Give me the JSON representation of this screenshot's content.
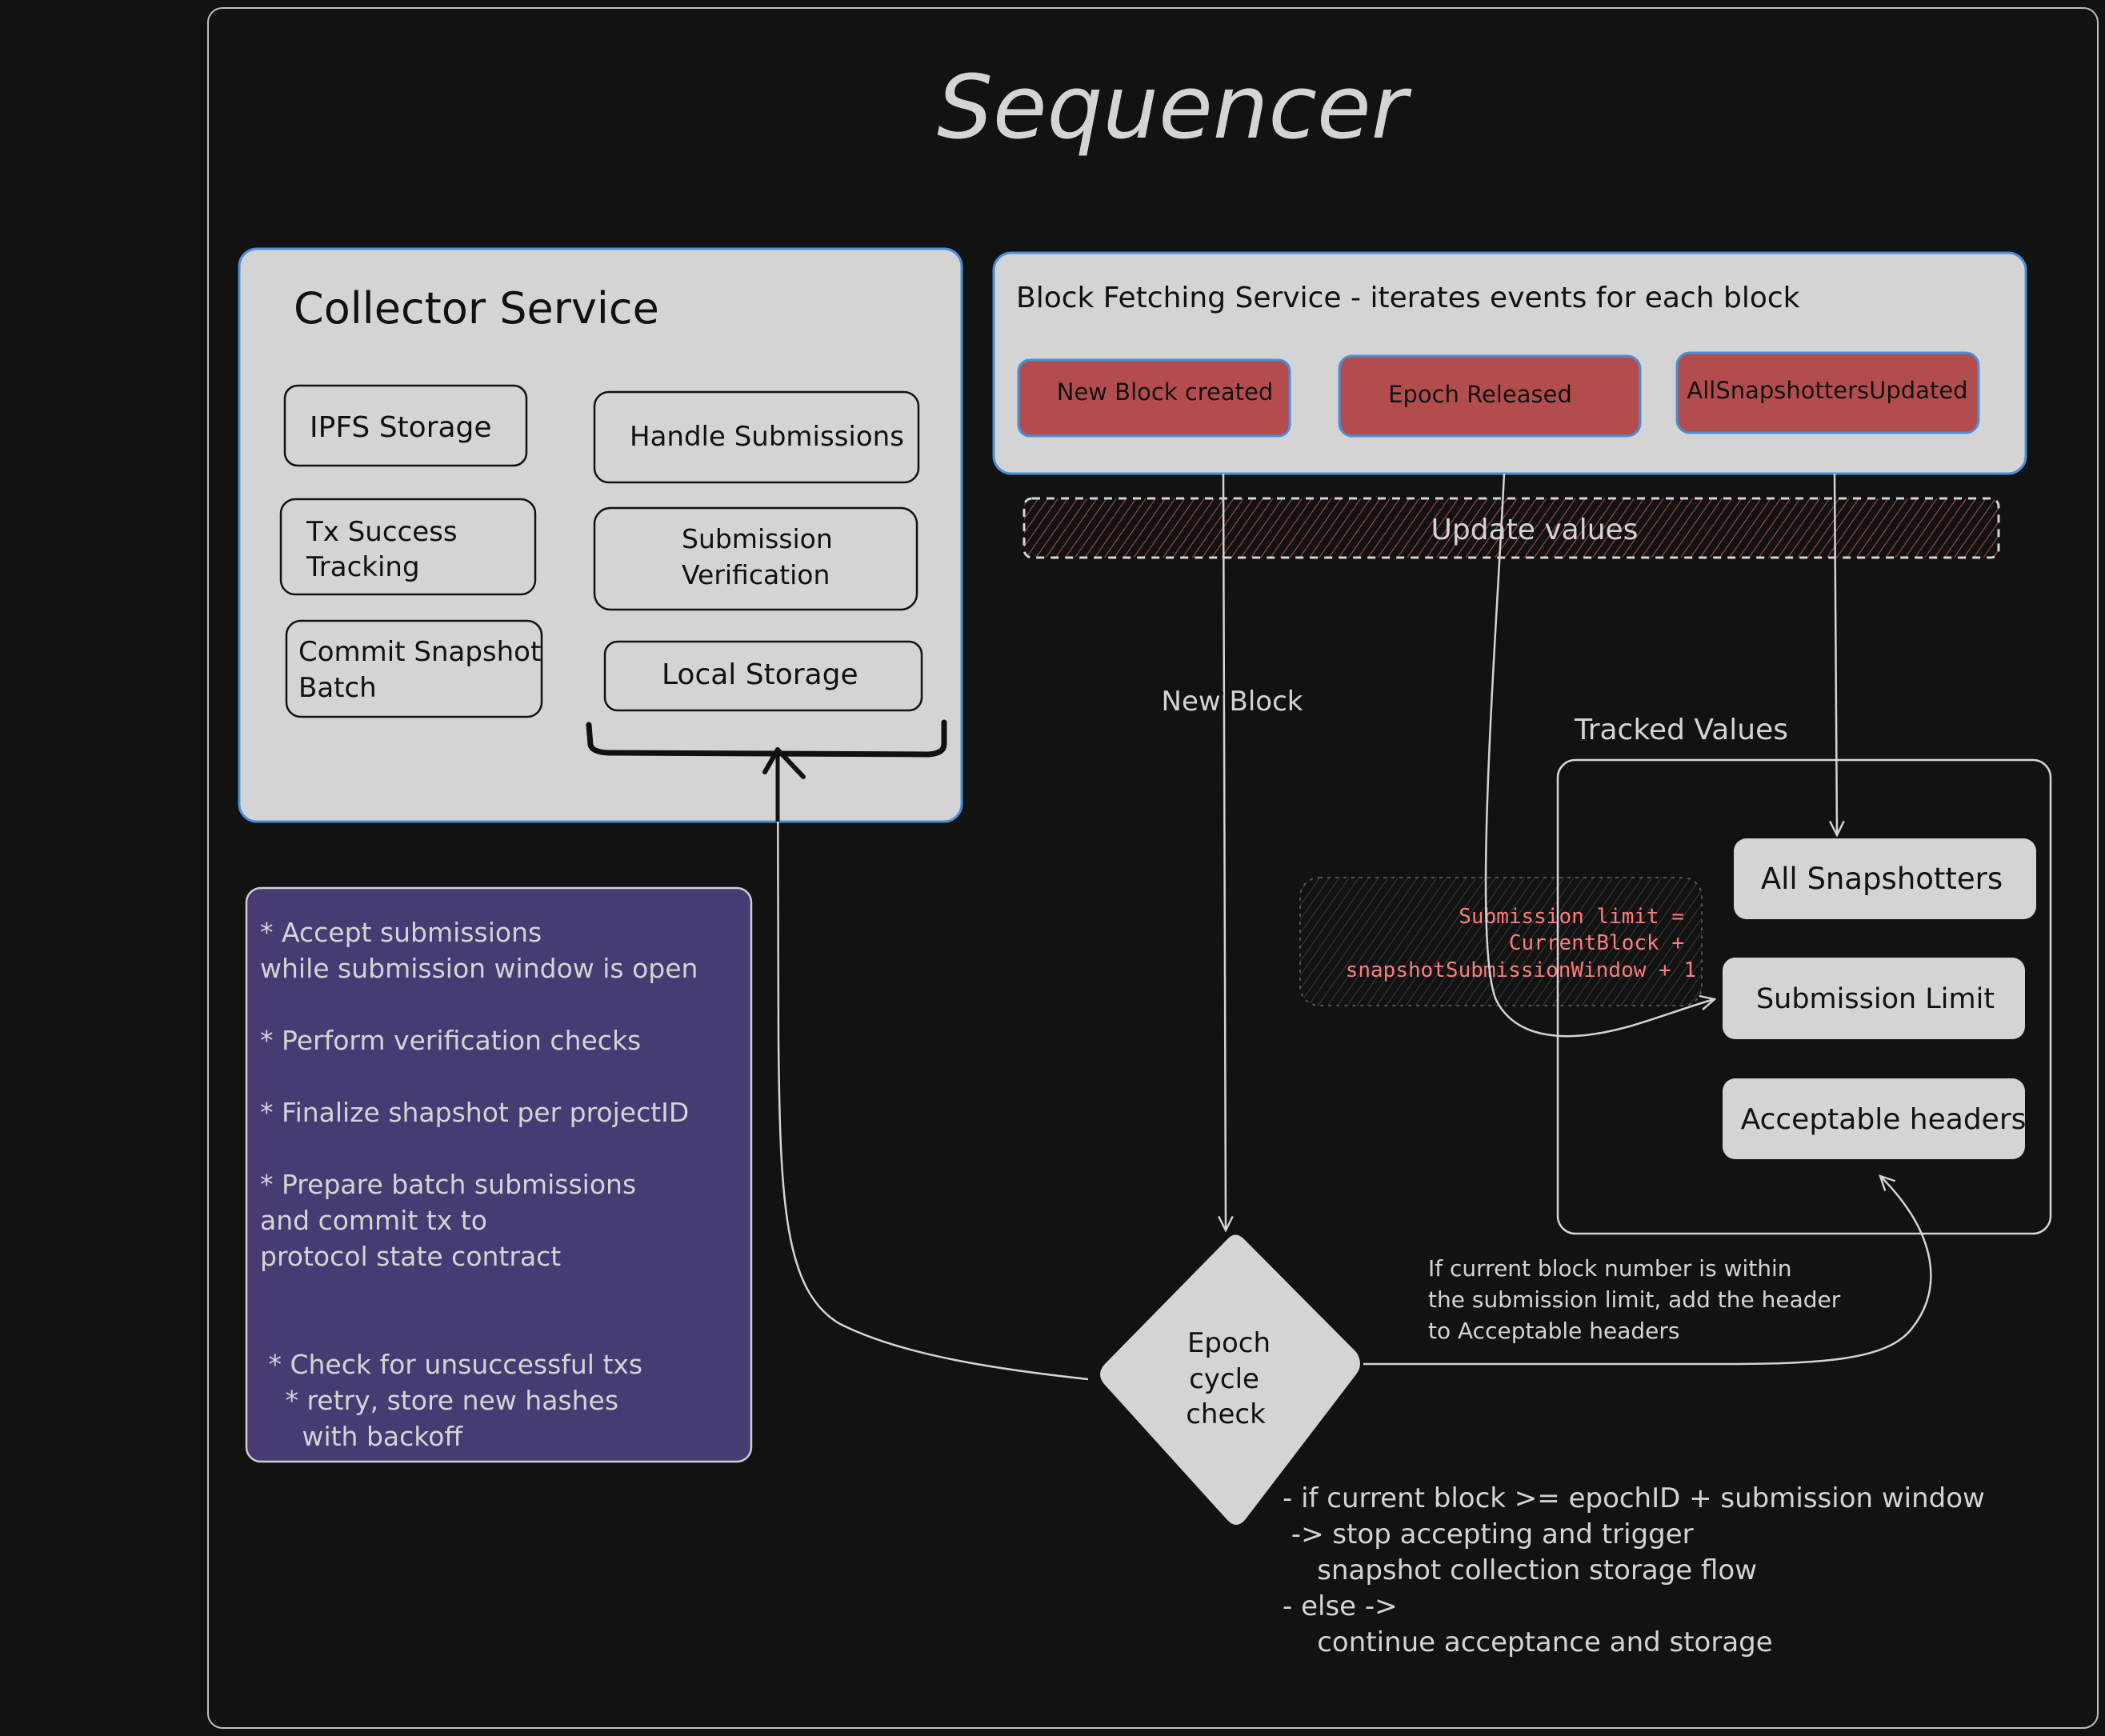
{
  "diagram": {
    "title": "Sequencer",
    "colors": {
      "background": "#121212",
      "panel_fill": "#d4d4d4",
      "panel_border_accent": "#4a90d9",
      "event_fill": "#b34d4d",
      "notes_fill": "#483a72",
      "formula_text": "#ff7b7b",
      "stroke_light": "#d4d4d4"
    },
    "collector_service": {
      "title": "Collector Service",
      "components": [
        {
          "id": "ipfs-storage",
          "lines": [
            "IPFS Storage"
          ]
        },
        {
          "id": "handle-submissions",
          "lines": [
            "Handle Submissions"
          ]
        },
        {
          "id": "tx-success-tracking",
          "lines": [
            "Tx Success",
            "Tracking"
          ]
        },
        {
          "id": "submission-verification",
          "lines": [
            "Submission",
            "Verification"
          ]
        },
        {
          "id": "commit-snapshot-batch",
          "lines": [
            "Commit Snapshot",
            "Batch"
          ]
        },
        {
          "id": "local-storage",
          "lines": [
            "Local Storage"
          ]
        }
      ]
    },
    "block_fetching_service": {
      "title": "Block Fetching Service - iterates events for each block",
      "events": [
        {
          "id": "new-block-created",
          "label": "New Block created"
        },
        {
          "id": "epoch-released",
          "label": "Epoch Released"
        },
        {
          "id": "all-snapshotters-updated",
          "label": "AllSnapshottersUpdated"
        }
      ]
    },
    "update_values_label": "Update values",
    "new_block_label": "New Block",
    "tracked_values": {
      "title": "Tracked Values",
      "items": [
        {
          "id": "all-snapshotters",
          "label": "All Snapshotters"
        },
        {
          "id": "submission-limit",
          "label": "Submission Limit"
        },
        {
          "id": "acceptable-headers",
          "label": "Acceptable headers"
        }
      ]
    },
    "formula": {
      "lines": [
        "Submission limit =",
        "CurrentBlock +",
        "snapshotSubmissionWindow + 1"
      ]
    },
    "notes": {
      "lines": [
        "* Accept submissions",
        "while submission window is open",
        "",
        "* Perform verification checks",
        "",
        "* Finalize shapshot per projectID",
        "",
        "* Prepare batch submissions",
        "and commit tx to",
        "protocol state contract",
        "",
        "",
        " * Check for unsuccessful txs",
        "   * retry, store new hashes",
        "     with backoff"
      ]
    },
    "decision": {
      "lines": [
        "Epoch",
        "cycle",
        "check"
      ]
    },
    "acceptable_note": {
      "lines": [
        "If current block number is within",
        "the submission limit, add the header",
        "to Acceptable headers"
      ]
    },
    "epoch_rule": {
      "lines": [
        "- if current block >= epochID + submission window",
        " -> stop accepting and trigger",
        "    snapshot collection storage flow",
        "- else ->",
        "    continue acceptance and storage"
      ]
    }
  }
}
